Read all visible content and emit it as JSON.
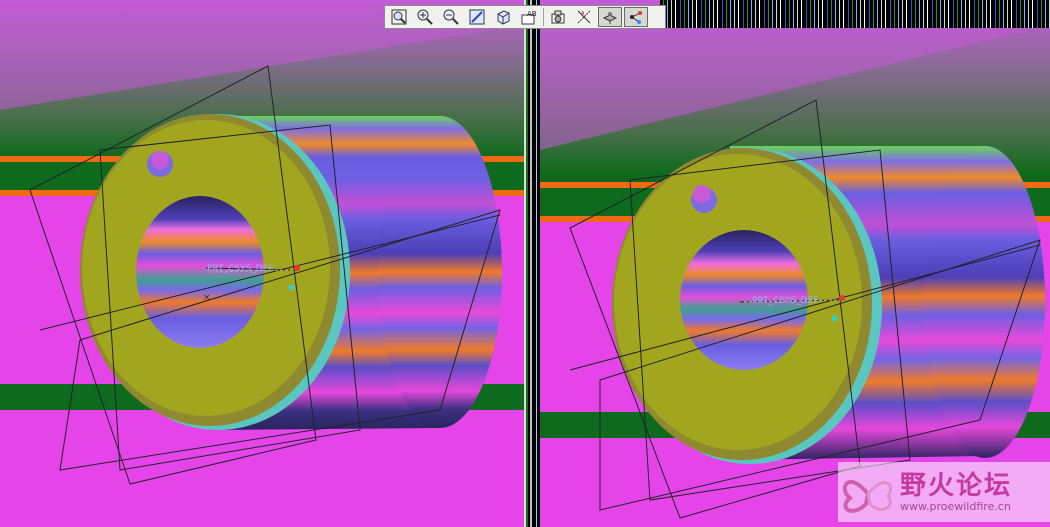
{
  "viewports": [
    {
      "id": "left",
      "csys_label": "PRT_CSYS_DEF"
    },
    {
      "id": "right",
      "csys_label": "PRT_CSYS_DEF"
    }
  ],
  "toolbar": {
    "buttons": [
      {
        "name": "zoom-fit-icon",
        "label": "Refit"
      },
      {
        "name": "zoom-in-icon",
        "label": "Zoom In"
      },
      {
        "name": "zoom-out-icon",
        "label": "Zoom Out"
      },
      {
        "name": "repaint-icon",
        "label": "Repaint"
      },
      {
        "name": "orient-icon",
        "label": "Orientation"
      },
      {
        "name": "saved-views-icon",
        "label": "Saved Views"
      },
      {
        "name": "layers-icon",
        "label": "Layers"
      },
      {
        "name": "datum-axes-icon",
        "label": "Datum Axes"
      },
      {
        "name": "datum-planes-icon",
        "label": "Datum Planes"
      },
      {
        "name": "csys-display-icon",
        "label": "Coordinate Systems"
      }
    ]
  },
  "watermark": {
    "title": "野火论坛",
    "url": "www.proewildfire.cn"
  },
  "colors": {
    "bg_top": "#c05bd8",
    "bg_mid": "#3f7a4a",
    "green_band": "#0e6a1c",
    "orange_band": "#f06a14",
    "magenta": "#e545e8",
    "olive_face": "#a2a61e",
    "body_blue": "#6a5ee0",
    "datum": "#22222a"
  }
}
